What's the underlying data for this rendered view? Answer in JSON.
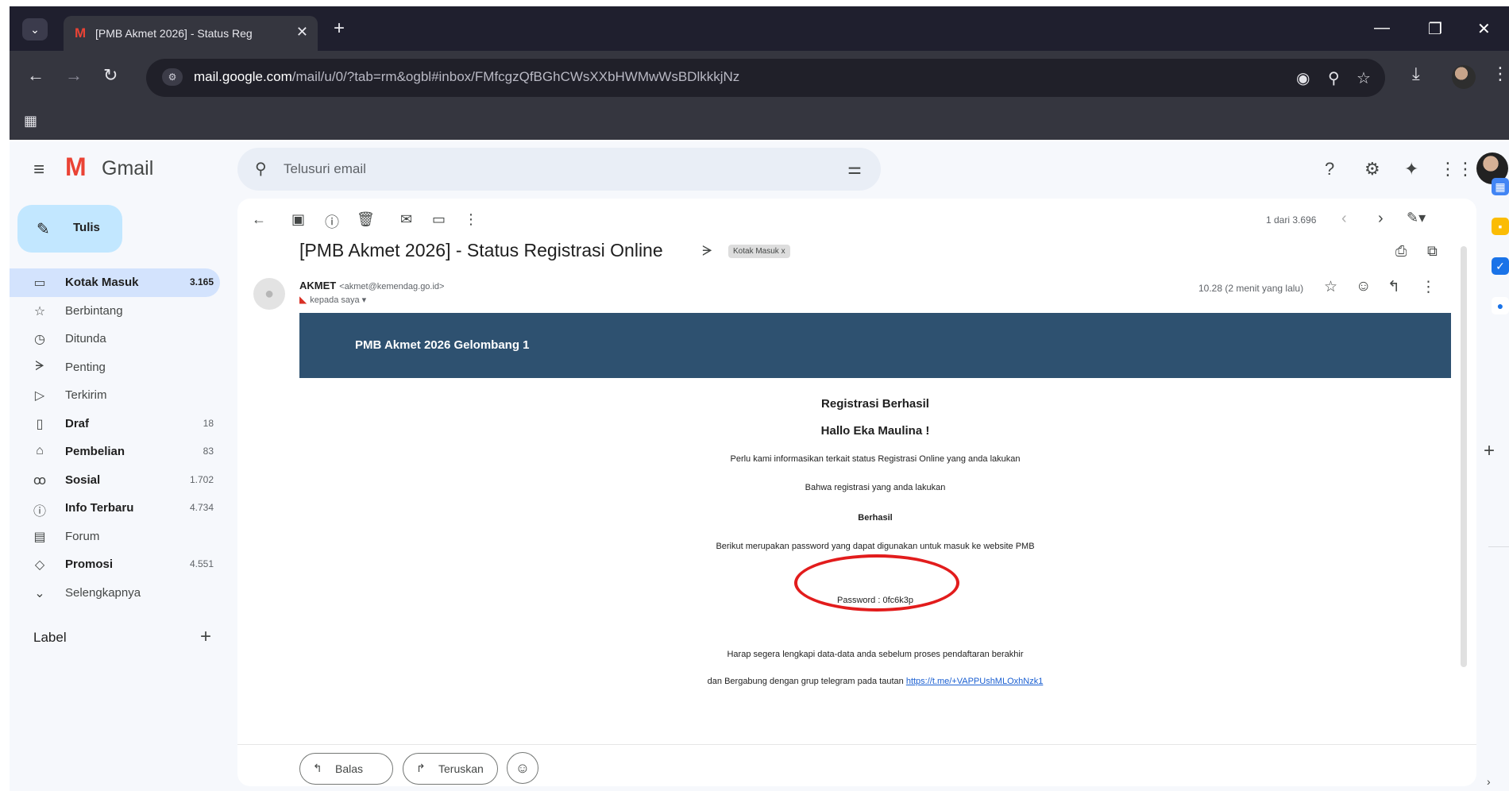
{
  "browser": {
    "tab_title": "[PMB Akmet 2026] - Status Reg",
    "tab_favicon": "M",
    "url_host": "mail.google.com",
    "url_rest": "/mail/u/0/?tab=rm&ogbl#inbox/FMfcgzQfBGhCWsXXbHWMwWsBDlkkkjNz",
    "icons": {
      "tab_dropdown": "chevron-down-icon",
      "close_tab": "close-icon",
      "new_tab": "plus-icon",
      "back": "arrow-left-icon",
      "forward": "arrow-right-icon",
      "reload": "reload-icon",
      "site_info": "tune-icon",
      "eye": "eye-icon",
      "zoom": "zoom-icon",
      "star": "star-icon",
      "download": "download-icon",
      "menu": "kebab-icon",
      "apps": "apps-grid-icon"
    }
  },
  "gmail": {
    "logo_text": "Gmail",
    "search_placeholder": "Telusuri email",
    "compose_label": "Tulis",
    "nav": [
      {
        "label": "Kotak Masuk",
        "count": "3.165",
        "bold": true,
        "active": true,
        "icon": "inbox-icon",
        "glyph": "▭"
      },
      {
        "label": "Berbintang",
        "count": "",
        "bold": false,
        "active": false,
        "icon": "star-icon",
        "glyph": "☆"
      },
      {
        "label": "Ditunda",
        "count": "",
        "bold": false,
        "active": false,
        "icon": "clock-icon",
        "glyph": "◷"
      },
      {
        "label": "Penting",
        "count": "",
        "bold": false,
        "active": false,
        "icon": "important-icon",
        "glyph": "ᗒ"
      },
      {
        "label": "Terkirim",
        "count": "",
        "bold": false,
        "active": false,
        "icon": "send-icon",
        "glyph": "▷"
      },
      {
        "label": "Draf",
        "count": "18",
        "bold": true,
        "active": false,
        "icon": "draft-icon",
        "glyph": "▯"
      },
      {
        "label": "Pembelian",
        "count": "83",
        "bold": true,
        "active": false,
        "icon": "shopping-bag-icon",
        "glyph": "⌂"
      },
      {
        "label": "Sosial",
        "count": "1.702",
        "bold": true,
        "active": false,
        "icon": "people-icon",
        "glyph": "ꝏ"
      },
      {
        "label": "Info Terbaru",
        "count": "4.734",
        "bold": true,
        "active": false,
        "icon": "info-icon",
        "glyph": "ⓘ"
      },
      {
        "label": "Forum",
        "count": "",
        "bold": false,
        "active": false,
        "icon": "forum-icon",
        "glyph": "▤"
      },
      {
        "label": "Promosi",
        "count": "4.551",
        "bold": true,
        "active": false,
        "icon": "tag-icon",
        "glyph": "◇"
      },
      {
        "label": "Selengkapnya",
        "count": "",
        "bold": false,
        "active": false,
        "icon": "chevron-down-icon",
        "glyph": "⌄"
      }
    ],
    "label_heading": "Label",
    "pager_text": "1 dari 3.696"
  },
  "email": {
    "subject": "[PMB Akmet 2026] - Status Registrasi Online",
    "inbox_chip": "Kotak Masuk x",
    "sender_name": "AKMET",
    "sender_email": "<akmet@kemendag.go.id>",
    "to_line": "kepada saya ▾",
    "time": "10.28 (2 menit yang lalu)",
    "banner": "PMB Akmet 2026 Gelombang 1",
    "title": "Registrasi Berhasil",
    "greeting": "Hallo Eka Maulina !",
    "line1": "Perlu kami informasikan terkait status Registrasi Online yang anda lakukan",
    "line2": "Bahwa registrasi yang anda lakukan",
    "status": "Berhasil",
    "line3": "Berikut merupakan password yang dapat digunakan untuk masuk ke website PMB",
    "password_line": "Password : 0fc6k3p",
    "line4": "Harap segera lengkapi data-data anda sebelum proses pendaftaran berakhir",
    "line5_prefix": "dan Bergabung dengan grup telegram pada tautan",
    "telegram_link": "https://t.me/+VAPPUshMLOxhNzk1",
    "reply_label": "Balas",
    "forward_label": "Teruskan"
  },
  "colors": {
    "banner": "#2e5170",
    "compose": "#c2e7ff",
    "active_nav": "#d3e3fd",
    "highlight_circle": "#e21c1c"
  }
}
